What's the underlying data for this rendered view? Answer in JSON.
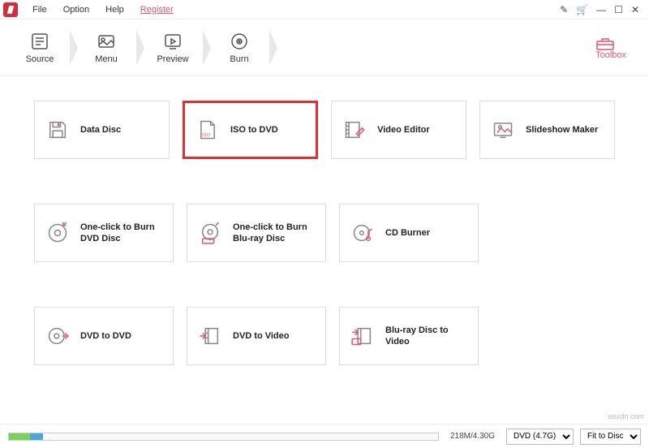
{
  "menubar": {
    "file": "File",
    "option": "Option",
    "help": "Help",
    "register": "Register"
  },
  "toolbar": {
    "source": "Source",
    "menu": "Menu",
    "preview": "Preview",
    "burn": "Burn",
    "toolbox": "Toolbox"
  },
  "cards": {
    "data_disc": "Data Disc",
    "iso_to_dvd": "ISO to DVD",
    "video_editor": "Video Editor",
    "slideshow_maker": "Slideshow Maker",
    "one_click_dvd": "One-click to Burn DVD Disc",
    "one_click_bluray": "One-click to Burn Blu-ray Disc",
    "cd_burner": "CD Burner",
    "dvd_to_dvd": "DVD to DVD",
    "dvd_to_video": "DVD to Video",
    "bluray_to_video": "Blu-ray Disc to Video"
  },
  "status": {
    "size": "218M/4.30G",
    "disc_type": "DVD (4.7G)",
    "fit": "Fit to Disc"
  },
  "attribution": "wsxdn.com"
}
